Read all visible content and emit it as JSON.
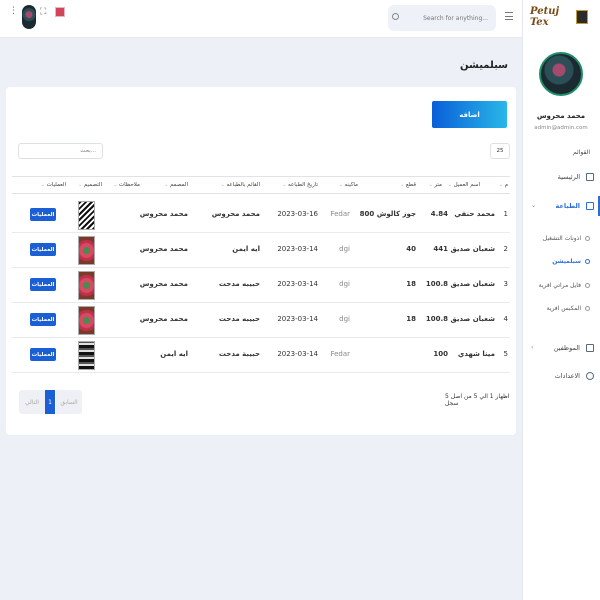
{
  "brand": {
    "logo_text": "Petuj Tex"
  },
  "user": {
    "name": "محمد محروس",
    "email": "admin@admin.com"
  },
  "sidebar": {
    "section_title": "القوائم",
    "items": [
      {
        "label": "الرئيسية"
      },
      {
        "label": "الطباعة"
      },
      {
        "label": "الموظفين"
      },
      {
        "label": "الاعدادات"
      }
    ],
    "subitems": [
      {
        "label": "اذونات التشغيل"
      },
      {
        "label": "سبلميشن"
      },
      {
        "label": "فايل مراتي افرية"
      },
      {
        "label": "المكبس افرية"
      }
    ]
  },
  "topbar": {
    "search_placeholder": "Search for anything..."
  },
  "page": {
    "title": "سبلميشن"
  },
  "card": {
    "add_label": "اضافه",
    "search_placeholder": "بحث...",
    "page_length": "25"
  },
  "table": {
    "headers": [
      "م",
      "اسم العميل",
      "متر",
      "قطع",
      "ماكينه",
      "تاريخ الطباعه",
      "القائم بالطباعه",
      "المصمم",
      "ملاحظات",
      "التصميم",
      "العمليات"
    ],
    "rows": [
      {
        "no": "1",
        "client": "محمد حنفي",
        "meters": "4.84",
        "pieces": "800 جوز كالوش",
        "machine": "Fedar",
        "date": "2023-03-16",
        "printer": "محمد محروس",
        "designer": "محمد محروس",
        "notes": "",
        "design": "zebra",
        "ops": "العمليات"
      },
      {
        "no": "2",
        "client": "شعبان صديق",
        "meters": "441",
        "pieces": "40",
        "machine": "dgi",
        "date": "2023-03-14",
        "printer": "ايه ايمن",
        "designer": "محمد محروس",
        "notes": "",
        "design": "rose",
        "ops": "العمليات"
      },
      {
        "no": "3",
        "client": "شعبان صديق",
        "meters": "100.8",
        "pieces": "18",
        "machine": "dgi",
        "date": "2023-03-14",
        "printer": "حبيبه مدحت",
        "designer": "محمد محروس",
        "notes": "",
        "design": "rose",
        "ops": "العمليات"
      },
      {
        "no": "4",
        "client": "شعبان صديق",
        "meters": "100.8",
        "pieces": "18",
        "machine": "dgi",
        "date": "2023-03-14",
        "printer": "حبيبه مدحت",
        "designer": "محمد محروس",
        "notes": "",
        "design": "rose",
        "ops": "العمليات"
      },
      {
        "no": "5",
        "client": "مينا شهدي",
        "meters": "100",
        "pieces": "",
        "machine": "Fedar",
        "date": "2023-03-14",
        "printer": "حبيبة مدحت",
        "designer": "ايه ايمن",
        "notes": "",
        "design": "bw",
        "ops": "العمليات"
      }
    ]
  },
  "footer": {
    "info": "اظهار 1 الي 5 من اصل 5 سجل",
    "prev": "السابق",
    "page": "1",
    "next": "التالي"
  },
  "colors": {
    "accent": "#1a5fd6",
    "gradient_end": "#29b7e8",
    "background": "#eef0f7"
  }
}
